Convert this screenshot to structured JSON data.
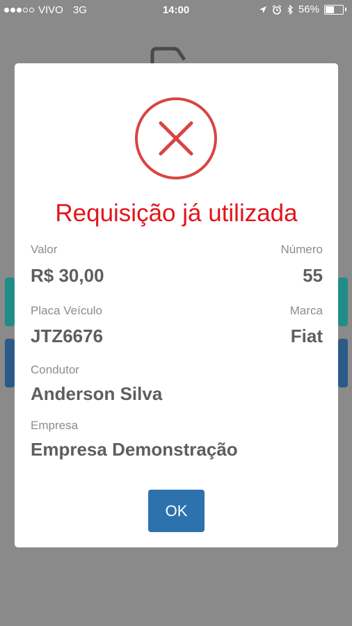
{
  "status_bar": {
    "carrier": "VIVO",
    "network": "3G",
    "time": "14:00",
    "battery": "56%",
    "icons": [
      "location-icon",
      "alarm-icon",
      "bluetooth-icon",
      "battery-icon"
    ]
  },
  "modal": {
    "icon": "error-x-icon",
    "title": "Requisição já utilizada",
    "valor_label": "Valor",
    "valor": "R$ 30,00",
    "numero_label": "Número",
    "numero": "55",
    "placa_label": "Placa Veículo",
    "placa": "JTZ6676",
    "marca_label": "Marca",
    "marca": "Fiat",
    "condutor_label": "Condutor",
    "condutor": "Anderson Silva",
    "empresa_label": "Empresa",
    "empresa": "Empresa Demonstração",
    "ok_label": "OK"
  },
  "colors": {
    "error_red": "#e0151b",
    "button_blue": "#2d72ad",
    "overlay_gray": "#8a8a8a"
  }
}
